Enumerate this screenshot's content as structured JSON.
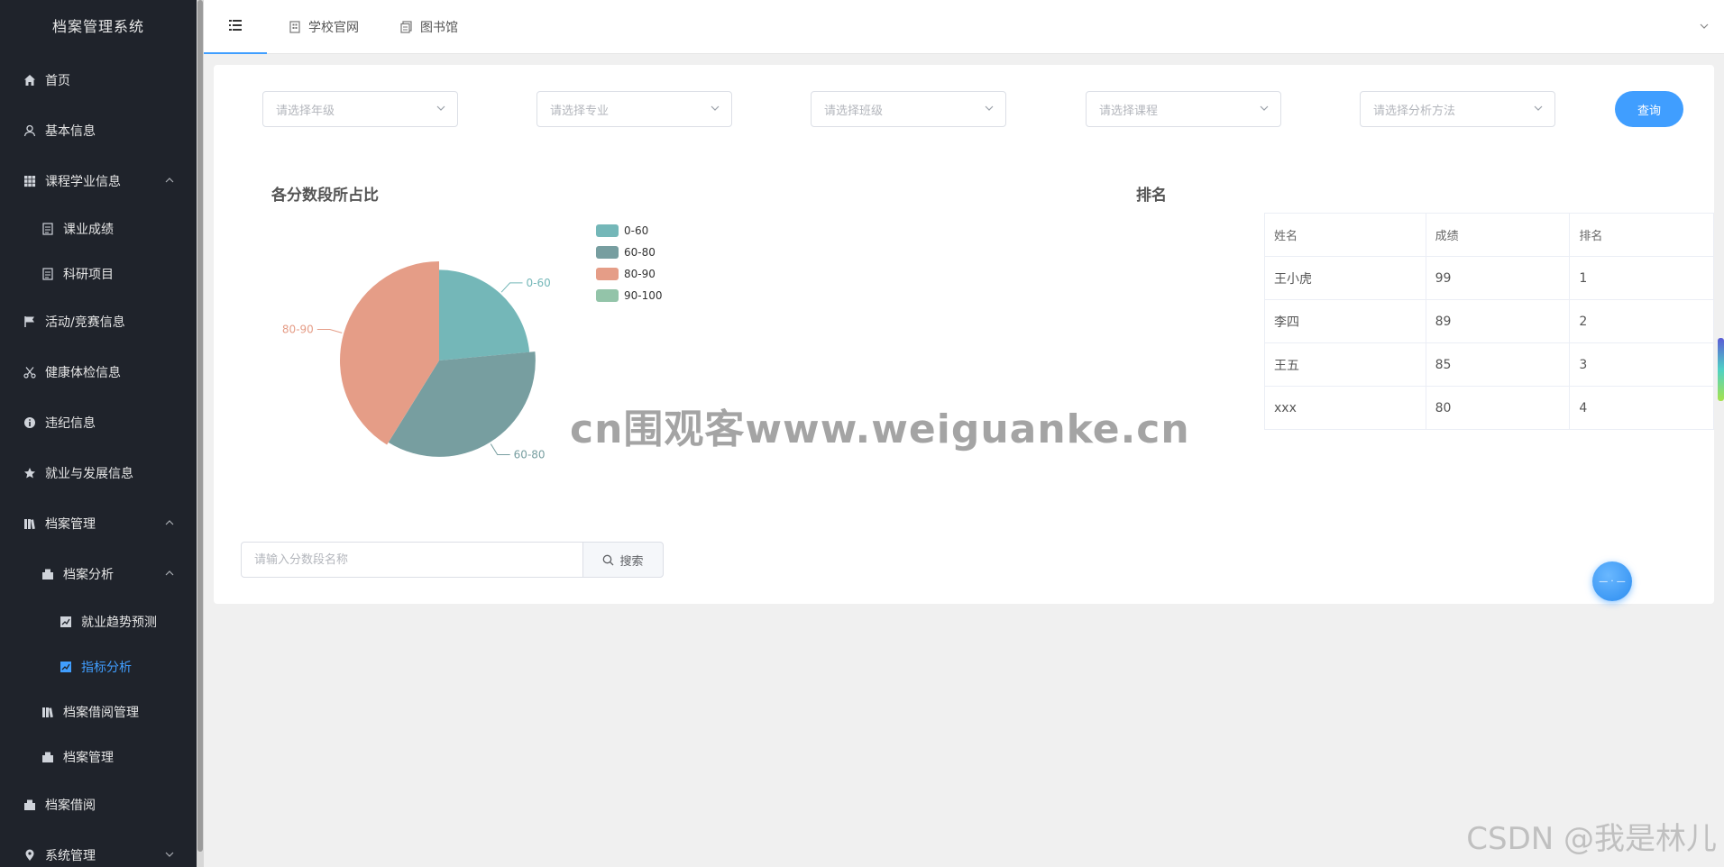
{
  "sidebar": {
    "brand": "档案管理系统",
    "items": [
      {
        "label": "首页",
        "icon": "home-icon"
      },
      {
        "label": "基本信息",
        "icon": "user-icon"
      },
      {
        "label": "课程学业信息",
        "icon": "grid-icon"
      },
      {
        "label": "课业成绩",
        "icon": "document-icon"
      },
      {
        "label": "科研项目",
        "icon": "document-icon"
      },
      {
        "label": "活动/竞赛信息",
        "icon": "flag-icon"
      },
      {
        "label": "健康体检信息",
        "icon": "scissors-icon"
      },
      {
        "label": "违纪信息",
        "icon": "info-icon"
      },
      {
        "label": "就业与发展信息",
        "icon": "star-icon"
      },
      {
        "label": "档案管理",
        "icon": "books-icon"
      },
      {
        "label": "档案分析",
        "icon": "box-icon"
      },
      {
        "label": "就业趋势预测",
        "icon": "chart-icon"
      },
      {
        "label": "指标分析",
        "icon": "chart-icon"
      },
      {
        "label": "档案借阅管理",
        "icon": "books-icon"
      },
      {
        "label": "档案管理",
        "icon": "box-icon"
      },
      {
        "label": "档案借阅",
        "icon": "box-icon"
      },
      {
        "label": "系统管理",
        "icon": "location-icon"
      }
    ]
  },
  "topbar": {
    "tabs": [
      {
        "label": "学校官网",
        "icon": "building-icon"
      },
      {
        "label": "图书馆",
        "icon": "library-icon"
      }
    ]
  },
  "filters": {
    "grade": "请选择年级",
    "major": "请选择专业",
    "class": "请选择班级",
    "course": "请选择课程",
    "method": "请选择分析方法",
    "query_label": "查询"
  },
  "pie_section": {
    "title": "各分数段所占比"
  },
  "chart_data": {
    "type": "pie",
    "categories": [
      "0-60",
      "60-80",
      "80-90",
      "90-100"
    ],
    "values": [
      20,
      30,
      35,
      0
    ],
    "colors": [
      "#74b7b8",
      "#779ea0",
      "#e59d87",
      "#93c4a9"
    ],
    "legend": "top-right"
  },
  "ranking": {
    "title": "排名",
    "headers": [
      "姓名",
      "成绩",
      "排名"
    ],
    "rows": [
      [
        "王小虎",
        "99",
        "1"
      ],
      [
        "李四",
        "89",
        "2"
      ],
      [
        "王五",
        "85",
        "3"
      ],
      [
        "xxx",
        "80",
        "4"
      ]
    ]
  },
  "search": {
    "placeholder": "请输入分数段名称",
    "button_label": "搜索"
  },
  "watermark": "cn围观客www.weiguanke.cn",
  "footer_watermark": "CSDN @我是林儿"
}
